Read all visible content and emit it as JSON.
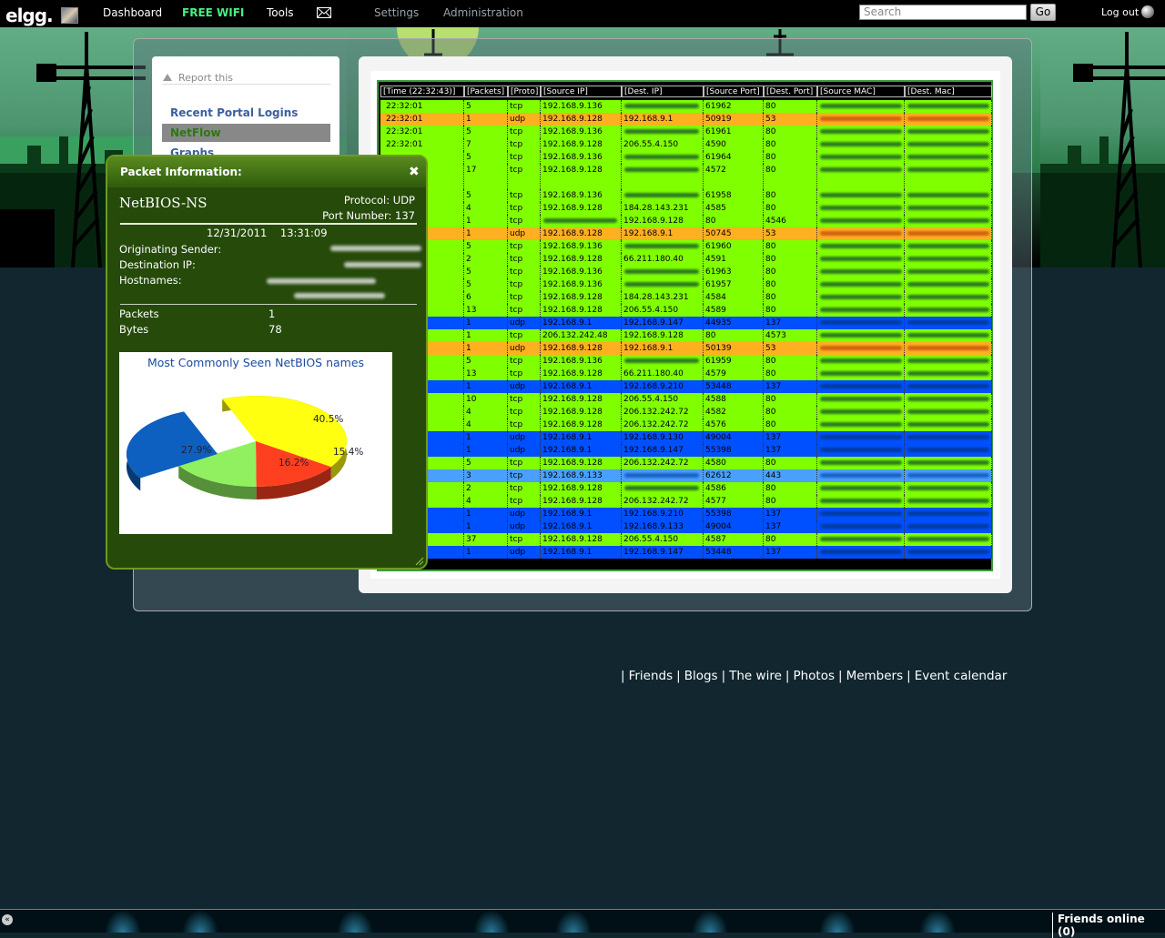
{
  "topbar": {
    "logo": "elgg.",
    "nav": [
      "Dashboard",
      "FREE WIFI",
      "Tools",
      "Settings",
      "Administration"
    ],
    "search_placeholder": "Search",
    "go_label": "Go",
    "logout_label": "Log out"
  },
  "sidebar": {
    "report_label": "Report this",
    "items": [
      "Recent Portal Logins",
      "NetFlow",
      "Graphs"
    ],
    "active": "NetFlow"
  },
  "table": {
    "headers": [
      "[Time (22:32:43)]",
      "[Packets]",
      "[Proto]",
      "[Source IP]",
      "[Dest. IP]",
      "[Source Port]",
      "[Dest. Port]",
      "[Source MAC]",
      "[Dest. Mac]"
    ],
    "rows": [
      {
        "time": "22:32:01",
        "packets": "5",
        "proto": "tcp",
        "src": "192.168.9.136",
        "dst": "",
        "sport": "61962",
        "dport": "80",
        "color": "green"
      },
      {
        "time": "22:32:01",
        "packets": "1",
        "proto": "udp",
        "src": "192.168.9.128",
        "dst": "192.168.9.1",
        "sport": "50919",
        "dport": "53",
        "color": "orange"
      },
      {
        "time": "22:32:01",
        "packets": "5",
        "proto": "tcp",
        "src": "192.168.9.136",
        "dst": "",
        "sport": "61961",
        "dport": "80",
        "color": "green"
      },
      {
        "time": "22:32:01",
        "packets": "7",
        "proto": "tcp",
        "src": "192.168.9.128",
        "dst": "206.55.4.150",
        "sport": "4590",
        "dport": "80",
        "color": "green"
      },
      {
        "time": "",
        "packets": "5",
        "proto": "tcp",
        "src": "192.168.9.136",
        "dst": "",
        "sport": "61964",
        "dport": "80",
        "color": "green"
      },
      {
        "time": "",
        "packets": "17",
        "proto": "tcp",
        "src": "192.168.9.128",
        "dst": "",
        "sport": "4572",
        "dport": "80",
        "color": "green",
        "tall": true
      },
      {
        "time": "",
        "packets": "5",
        "proto": "tcp",
        "src": "192.168.9.136",
        "dst": "",
        "sport": "61958",
        "dport": "80",
        "color": "green"
      },
      {
        "time": "",
        "packets": "4",
        "proto": "tcp",
        "src": "192.168.9.128",
        "dst": "184.28.143.231",
        "sport": "4585",
        "dport": "80",
        "color": "green"
      },
      {
        "time": "",
        "packets": "1",
        "proto": "tcp",
        "src": "",
        "dst": "192.168.9.128",
        "sport": "80",
        "dport": "4546",
        "color": "green"
      },
      {
        "time": "",
        "packets": "1",
        "proto": "udp",
        "src": "192.168.9.128",
        "dst": "192.168.9.1",
        "sport": "50745",
        "dport": "53",
        "color": "orange"
      },
      {
        "time": "",
        "packets": "5",
        "proto": "tcp",
        "src": "192.168.9.136",
        "dst": "",
        "sport": "61960",
        "dport": "80",
        "color": "green"
      },
      {
        "time": "",
        "packets": "2",
        "proto": "tcp",
        "src": "192.168.9.128",
        "dst": "66.211.180.40",
        "sport": "4591",
        "dport": "80",
        "color": "green"
      },
      {
        "time": "",
        "packets": "5",
        "proto": "tcp",
        "src": "192.168.9.136",
        "dst": "",
        "sport": "61963",
        "dport": "80",
        "color": "green"
      },
      {
        "time": "",
        "packets": "5",
        "proto": "tcp",
        "src": "192.168.9.136",
        "dst": "",
        "sport": "61957",
        "dport": "80",
        "color": "green"
      },
      {
        "time": "",
        "packets": "6",
        "proto": "tcp",
        "src": "192.168.9.128",
        "dst": "184.28.143.231",
        "sport": "4584",
        "dport": "80",
        "color": "green"
      },
      {
        "time": "",
        "packets": "13",
        "proto": "tcp",
        "src": "192.168.9.128",
        "dst": "206.55.4.150",
        "sport": "4589",
        "dport": "80",
        "color": "green"
      },
      {
        "time": "",
        "packets": "1",
        "proto": "udp",
        "src": "192.168.9.1",
        "dst": "192.168.9.147",
        "sport": "44935",
        "dport": "137",
        "color": "blue"
      },
      {
        "time": "",
        "packets": "1",
        "proto": "tcp",
        "src": "206.132.242.48",
        "dst": "192.168.9.128",
        "sport": "80",
        "dport": "4573",
        "color": "green"
      },
      {
        "time": "",
        "packets": "1",
        "proto": "udp",
        "src": "192.168.9.128",
        "dst": "192.168.9.1",
        "sport": "50139",
        "dport": "53",
        "color": "orange"
      },
      {
        "time": "",
        "packets": "5",
        "proto": "tcp",
        "src": "192.168.9.136",
        "dst": "",
        "sport": "61959",
        "dport": "80",
        "color": "green"
      },
      {
        "time": "",
        "packets": "13",
        "proto": "tcp",
        "src": "192.168.9.128",
        "dst": "66.211.180.40",
        "sport": "4579",
        "dport": "80",
        "color": "green"
      },
      {
        "time": "",
        "packets": "1",
        "proto": "udp",
        "src": "192.168.9.1",
        "dst": "192.168.9.210",
        "sport": "53448",
        "dport": "137",
        "color": "blue"
      },
      {
        "time": "",
        "packets": "10",
        "proto": "tcp",
        "src": "192.168.9.128",
        "dst": "206.55.4.150",
        "sport": "4588",
        "dport": "80",
        "color": "green"
      },
      {
        "time": "",
        "packets": "4",
        "proto": "tcp",
        "src": "192.168.9.128",
        "dst": "206.132.242.72",
        "sport": "4582",
        "dport": "80",
        "color": "green"
      },
      {
        "time": "",
        "packets": "4",
        "proto": "tcp",
        "src": "192.168.9.128",
        "dst": "206.132.242.72",
        "sport": "4576",
        "dport": "80",
        "color": "green"
      },
      {
        "time": "",
        "packets": "1",
        "proto": "udp",
        "src": "192.168.9.1",
        "dst": "192.168.9.130",
        "sport": "49004",
        "dport": "137",
        "color": "blue"
      },
      {
        "time": "",
        "packets": "1",
        "proto": "udp",
        "src": "192.168.9.1",
        "dst": "192.168.9.147",
        "sport": "55398",
        "dport": "137",
        "color": "blue"
      },
      {
        "time": "",
        "packets": "5",
        "proto": "tcp",
        "src": "192.168.9.128",
        "dst": "206.132.242.72",
        "sport": "4580",
        "dport": "80",
        "color": "green"
      },
      {
        "time": "",
        "packets": "3",
        "proto": "tcp",
        "src": "192.168.9.133",
        "dst": "",
        "sport": "62612",
        "dport": "443",
        "color": "lightblue"
      },
      {
        "time": "",
        "packets": "2",
        "proto": "tcp",
        "src": "192.168.9.128",
        "dst": "",
        "sport": "4586",
        "dport": "80",
        "color": "green"
      },
      {
        "time": "",
        "packets": "4",
        "proto": "tcp",
        "src": "192.168.9.128",
        "dst": "206.132.242.72",
        "sport": "4577",
        "dport": "80",
        "color": "green"
      },
      {
        "time": "",
        "packets": "1",
        "proto": "udp",
        "src": "192.168.9.1",
        "dst": "192.168.9.210",
        "sport": "55398",
        "dport": "137",
        "color": "blue"
      },
      {
        "time": "",
        "packets": "1",
        "proto": "udp",
        "src": "192.168.9.1",
        "dst": "192.168.9.133",
        "sport": "49004",
        "dport": "137",
        "color": "blue"
      },
      {
        "time": "",
        "packets": "37",
        "proto": "tcp",
        "src": "192.168.9.128",
        "dst": "206.55.4.150",
        "sport": "4587",
        "dport": "80",
        "color": "green"
      },
      {
        "time": "",
        "packets": "1",
        "proto": "udp",
        "src": "192.168.9.1",
        "dst": "192.168.9.147",
        "sport": "53448",
        "dport": "137",
        "color": "blue"
      }
    ]
  },
  "popup": {
    "title": "Packet Information:",
    "name": "NetBIOS-NS",
    "protocol": "Protocol: UDP",
    "port": "Port Number: 137",
    "datetime": "12/31/2011    13:31:09",
    "originating_label": "Originating Sender:",
    "destination_label": "Destination IP:",
    "hostnames_label": "Hostnames:",
    "packets_label": "Packets",
    "packets_value": "1",
    "bytes_label": "Bytes",
    "bytes_value": "78"
  },
  "chart_data": {
    "type": "pie",
    "title": "Most Commonly Seen NetBIOS names",
    "slices": [
      {
        "label": "40.5%",
        "value": 40.5,
        "color": "#ffff10"
      },
      {
        "label": "15.4%",
        "value": 15.4,
        "color": "#ff4020"
      },
      {
        "label": "16.2%",
        "value": 16.2,
        "color": "#90f060"
      },
      {
        "label": "27.9%",
        "value": 27.9,
        "color": "#0d5fc0"
      }
    ]
  },
  "footer": {
    "links": [
      "Friends",
      "Blogs",
      "The wire",
      "Photos",
      "Members",
      "Event calendar"
    ],
    "friends_online": "Friends online (0)"
  },
  "colors": {
    "row_green": "#80ff00",
    "row_orange": "#ffb020",
    "row_blue": "#0050ff",
    "row_lightblue": "#4aa0ff",
    "popup_bg": "#254a0a"
  }
}
